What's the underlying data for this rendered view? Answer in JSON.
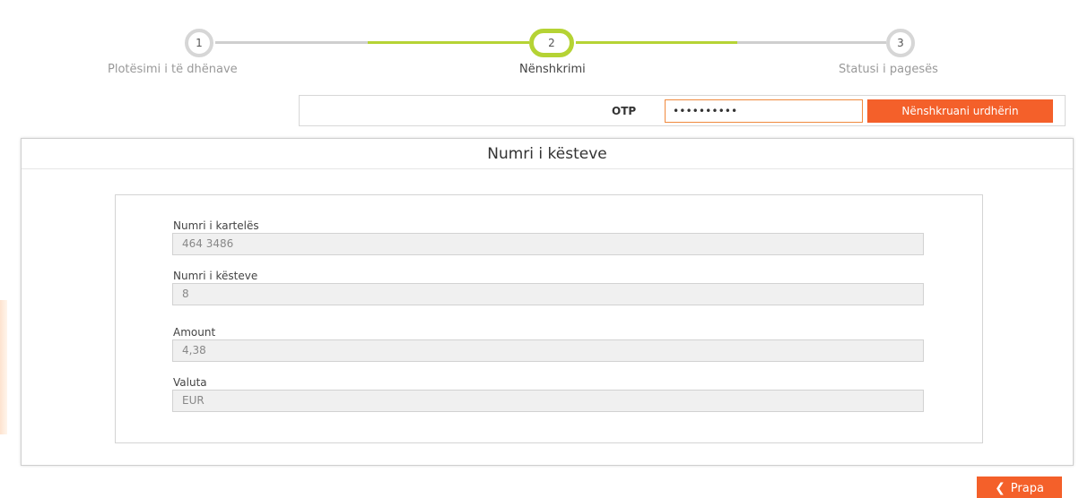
{
  "stepper": {
    "steps": [
      {
        "number": "1",
        "label": "Plotësimi i të dhënave"
      },
      {
        "number": "2",
        "label": "Nënshkrimi"
      },
      {
        "number": "3",
        "label": "Statusi i pagesës"
      }
    ]
  },
  "otp": {
    "label": "OTP",
    "value": "••••••••••",
    "button_label": "Nënshkruani urdhërin"
  },
  "panel": {
    "title": "Numri i kësteve",
    "fields": [
      {
        "label": "Numri i kartelës",
        "value": "464 3486"
      },
      {
        "label": "Numri i kësteve",
        "value": "8"
      },
      {
        "label": "Amount",
        "value": "4,38"
      },
      {
        "label": "Valuta",
        "value": "EUR"
      }
    ]
  },
  "footer": {
    "back_label": "Prapa",
    "back_icon": "chevron-left-icon"
  },
  "colors": {
    "accent_orange": "#f4602a",
    "step_active": "#b5d334",
    "step_inactive": "#d6d6d6"
  }
}
